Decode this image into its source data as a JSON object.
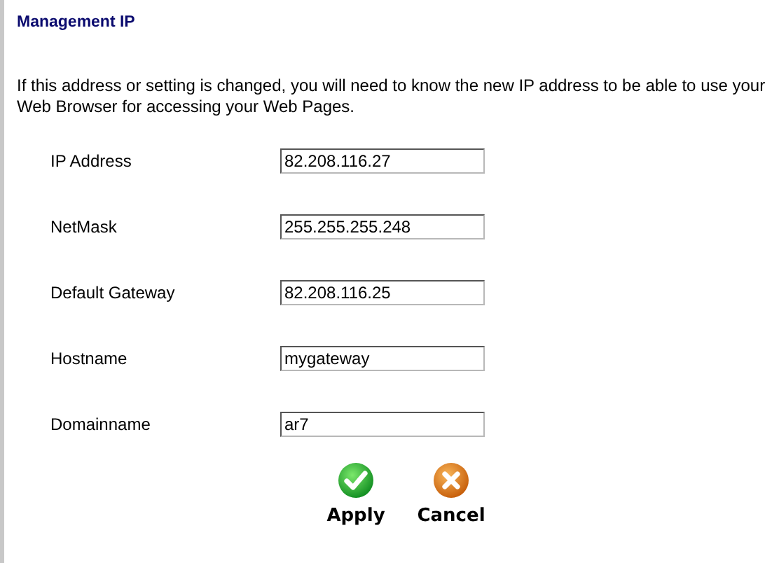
{
  "title": "Management IP",
  "intro": "If this address or setting is changed, you will need to know the new IP address to be able to use your Web Browser for accessing your Web Pages.",
  "fields": [
    {
      "label": "IP Address",
      "value": "82.208.116.27"
    },
    {
      "label": "NetMask",
      "value": "255.255.255.248"
    },
    {
      "label": "Default Gateway",
      "value": "82.208.116.25"
    },
    {
      "label": "Hostname",
      "value": "mygateway"
    },
    {
      "label": "Domainname",
      "value": "ar7"
    }
  ],
  "buttons": [
    {
      "label": "Apply",
      "kind": "apply"
    },
    {
      "label": "Cancel",
      "kind": "cancel"
    }
  ]
}
